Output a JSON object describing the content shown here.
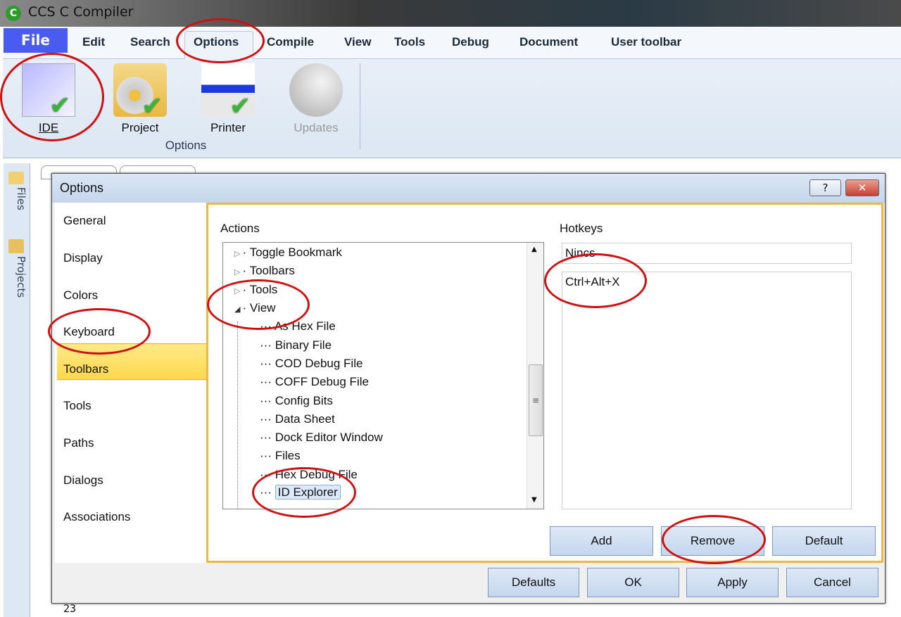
{
  "window": {
    "title": "CCS C Compiler"
  },
  "menu": {
    "file": "File",
    "items": [
      "Edit",
      "Search",
      "Options",
      "Compile",
      "View",
      "Tools",
      "Debug",
      "Document",
      "User toolbar"
    ]
  },
  "ribbon": {
    "buttons": [
      {
        "label": "IDE",
        "icon": "ide-window-icon"
      },
      {
        "label": "Project",
        "icon": "project-gear-icon"
      },
      {
        "label": "Printer",
        "icon": "printer-icon"
      },
      {
        "label": "Updates",
        "icon": "globe-update-icon",
        "disabled": true
      }
    ],
    "group_label": "Options"
  },
  "side_tabs": [
    "Files",
    "Projects"
  ],
  "editor": {
    "line_number": "23"
  },
  "dialog": {
    "title": "Options",
    "help": "?",
    "close": "✕",
    "nav": [
      "General",
      "Display",
      "Colors",
      "Keyboard",
      "Toolbars",
      "Tools",
      "Paths",
      "Dialogs",
      "Associations"
    ],
    "nav_selected": "Keyboard",
    "actions_label": "Actions",
    "tree": {
      "top": [
        {
          "label": "Toggle Bookmark",
          "state": "collapsed"
        },
        {
          "label": "Toolbars",
          "state": "collapsed"
        },
        {
          "label": "Tools",
          "state": "collapsed"
        },
        {
          "label": "View",
          "state": "expanded"
        }
      ],
      "children": [
        "As Hex File",
        "Binary File",
        "COD Debug File",
        "COFF Debug File",
        "Config Bits",
        "Data Sheet",
        "Dock Editor Window",
        "Files",
        "Hex Debug File",
        "ID Explorer"
      ],
      "selected": "ID Explorer"
    },
    "hotkeys_label": "Hotkeys",
    "hotkey_input": "Nincs",
    "hotkey_list": [
      "Ctrl+Alt+X"
    ],
    "panel_buttons": {
      "add": "Add",
      "remove": "Remove",
      "default": "Default"
    },
    "footer_buttons": {
      "defaults": "Defaults",
      "ok": "OK",
      "apply": "Apply",
      "cancel": "Cancel"
    }
  },
  "colors": {
    "file_button": "#4a5cf0",
    "selection": "#ffd84a",
    "panel_border": "#f0b840",
    "annotation": "#d01010"
  }
}
